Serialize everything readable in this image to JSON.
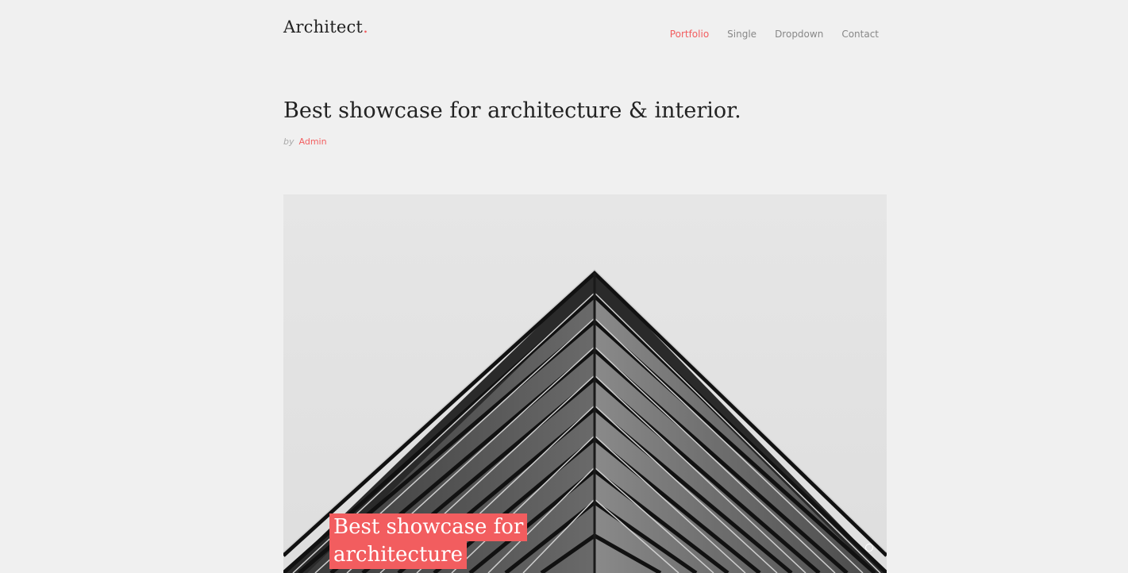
{
  "header": {
    "logo_text": "Architect",
    "logo_dot": ".",
    "nav": [
      {
        "label": "Portfolio",
        "active": true
      },
      {
        "label": "Single",
        "active": false
      },
      {
        "label": "Dropdown",
        "active": false
      },
      {
        "label": "Contact",
        "active": false
      }
    ]
  },
  "post": {
    "title": "Best showcase for architecture & interior.",
    "by_label": "by",
    "author": "Admin"
  },
  "hero": {
    "caption_line1": "Best showcase for",
    "caption_line2": "architecture",
    "image_subject": "building-corner-photo"
  },
  "colors": {
    "accent": "#f25d5f",
    "background": "#f0f0f0",
    "text": "#222222",
    "nav_text": "#888888"
  }
}
